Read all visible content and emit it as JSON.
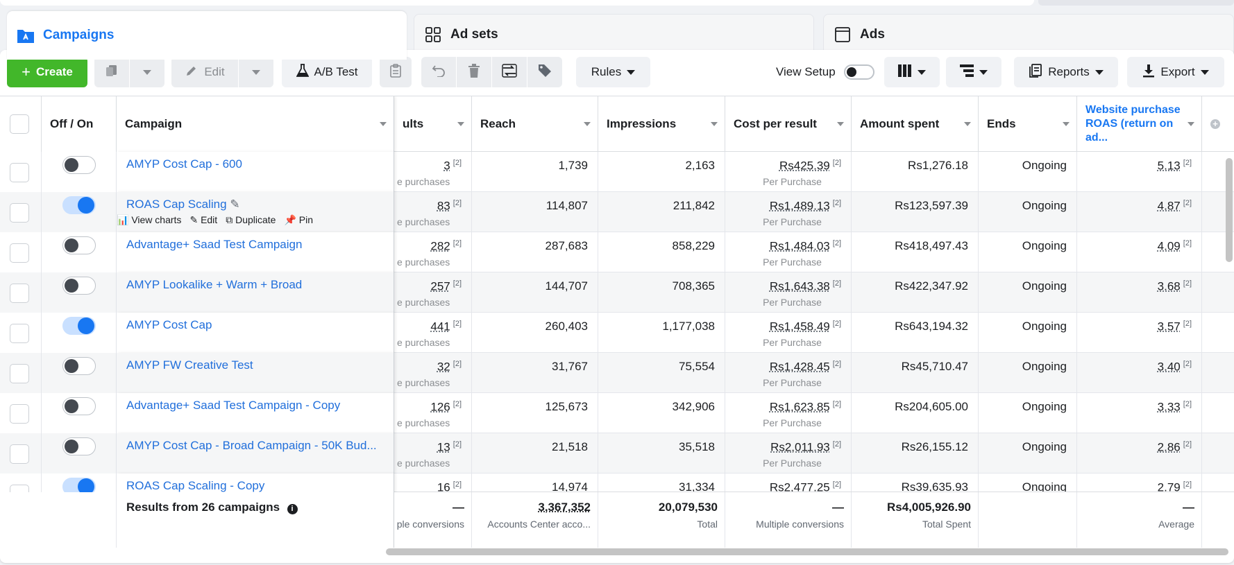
{
  "tabs": [
    {
      "label": "Campaigns",
      "icon": "campaigns-folder-icon"
    },
    {
      "label": "Ad sets",
      "icon": "adsets-grid-icon"
    },
    {
      "label": "Ads",
      "icon": "ads-window-icon"
    }
  ],
  "toolbar": {
    "create": "Create",
    "edit": "Edit",
    "ab_test": "A/B Test",
    "rules": "Rules",
    "view_setup": "View Setup",
    "reports": "Reports",
    "export": "Export"
  },
  "columns": {
    "off_on": "Off / On",
    "campaign": "Campaign",
    "results": "ults",
    "reach": "Reach",
    "impressions": "Impressions",
    "cost_per_result": "Cost per result",
    "amount_spent": "Amount spent",
    "ends": "Ends",
    "roas": "Website purchase ROAS (return on ad..."
  },
  "row_actions": {
    "view_charts": "View charts",
    "edit": "Edit",
    "duplicate": "Duplicate",
    "pin": "Pin"
  },
  "rows": [
    {
      "on": false,
      "name": "AMYP Cost Cap - 600",
      "results": "3",
      "results_sub": "e purchases",
      "reach": "1,739",
      "impressions": "2,163",
      "cost": "Rs425.39",
      "cost_sub": "Per Purchase",
      "spent": "Rs1,276.18",
      "ends": "Ongoing",
      "roas": "5.13"
    },
    {
      "on": true,
      "name": "ROAS Cap Scaling",
      "results": "83",
      "results_sub": "e purchases",
      "reach": "114,807",
      "impressions": "211,842",
      "cost": "Rs1,489.13",
      "cost_sub": "Per Purchase",
      "spent": "Rs123,597.39",
      "ends": "Ongoing",
      "roas": "4.87"
    },
    {
      "on": false,
      "name": "Advantage+ Saad Test Campaign",
      "results": "282",
      "results_sub": "e purchases",
      "reach": "287,683",
      "impressions": "858,229",
      "cost": "Rs1,484.03",
      "cost_sub": "Per Purchase",
      "spent": "Rs418,497.43",
      "ends": "Ongoing",
      "roas": "4.09"
    },
    {
      "on": false,
      "name": "AMYP Lookalike + Warm + Broad",
      "results": "257",
      "results_sub": "e purchases",
      "reach": "144,707",
      "impressions": "708,365",
      "cost": "Rs1,643.38",
      "cost_sub": "Per Purchase",
      "spent": "Rs422,347.92",
      "ends": "Ongoing",
      "roas": "3.68"
    },
    {
      "on": true,
      "name": "AMYP Cost Cap",
      "results": "441",
      "results_sub": "e purchases",
      "reach": "260,403",
      "impressions": "1,177,038",
      "cost": "Rs1,458.49",
      "cost_sub": "Per Purchase",
      "spent": "Rs643,194.32",
      "ends": "Ongoing",
      "roas": "3.57"
    },
    {
      "on": false,
      "name": "AMYP FW Creative Test",
      "results": "32",
      "results_sub": "e purchases",
      "reach": "31,767",
      "impressions": "75,554",
      "cost": "Rs1,428.45",
      "cost_sub": "Per Purchase",
      "spent": "Rs45,710.47",
      "ends": "Ongoing",
      "roas": "3.40"
    },
    {
      "on": false,
      "name": "Advantage+ Saad Test Campaign - Copy",
      "results": "126",
      "results_sub": "e purchases",
      "reach": "125,673",
      "impressions": "342,906",
      "cost": "Rs1,623.85",
      "cost_sub": "Per Purchase",
      "spent": "Rs204,605.00",
      "ends": "Ongoing",
      "roas": "3.33"
    },
    {
      "on": false,
      "name": "AMYP Cost Cap - Broad Campaign - 50K Bud...",
      "results": "13",
      "results_sub": "e purchases",
      "reach": "21,518",
      "impressions": "35,518",
      "cost": "Rs2,011.93",
      "cost_sub": "Per Purchase",
      "spent": "Rs26,155.12",
      "ends": "Ongoing",
      "roas": "2.86"
    },
    {
      "on": true,
      "name": "ROAS Cap Scaling - Copy",
      "results": "16",
      "results_sub": "",
      "reach": "14,974",
      "impressions": "31,334",
      "cost": "Rs2,477.25",
      "cost_sub": "",
      "spent": "Rs39,635.93",
      "ends": "Ongoing",
      "roas": "2.79"
    }
  ],
  "footer": {
    "label": "Results from 26 campaigns",
    "results": "—",
    "results_sub": "ple conversions",
    "reach": "3,367,352",
    "reach_sub": "Accounts Center acco...",
    "impressions": "20,079,530",
    "impressions_sub": "Total",
    "cost": "—",
    "cost_sub": "Multiple conversions",
    "spent": "Rs4,005,926.90",
    "spent_sub": "Total Spent",
    "roas": "—",
    "roas_sub": "Average"
  },
  "footnote": "[2]",
  "colors": {
    "accent": "#1877f2",
    "create": "#42b72a",
    "link": "#216fdb"
  }
}
